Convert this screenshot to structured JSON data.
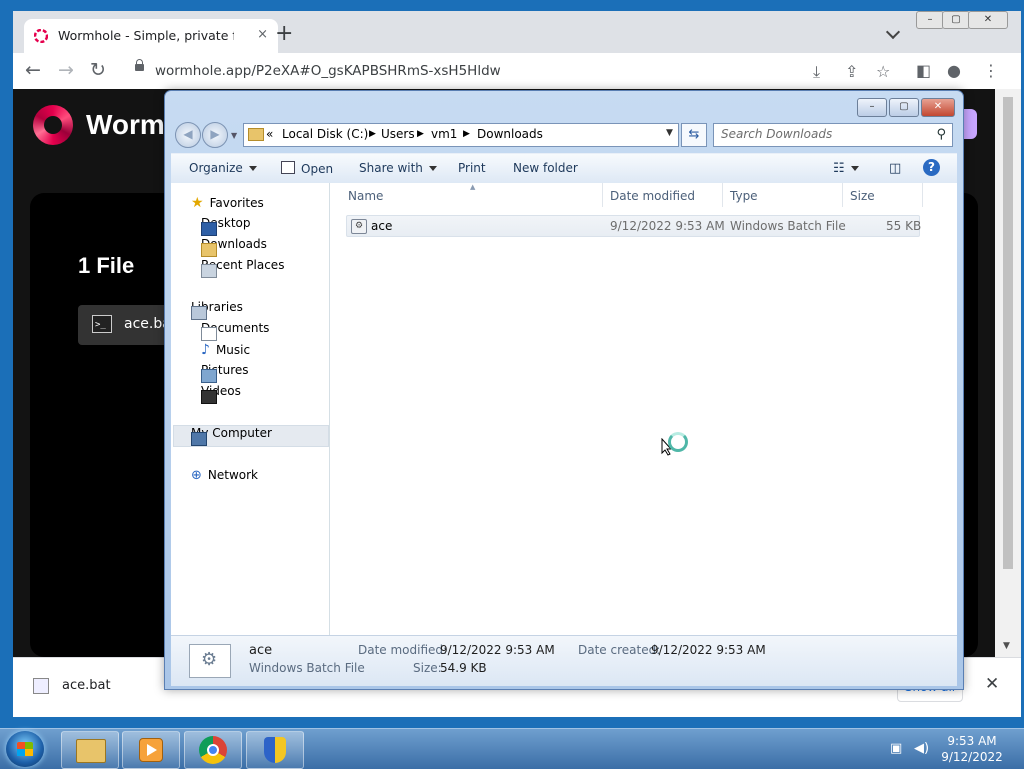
{
  "browser": {
    "tab_title": "Wormhole - Simple, private file s",
    "tab_close": "×",
    "new_tab": "+",
    "window_controls": [
      "–",
      "▢",
      "✕"
    ],
    "url": "wormhole.app/P2eXA#O_gsKAPBSHRmS-xsH5Hldw"
  },
  "wormhole_page": {
    "brand": "Worm",
    "files_heading": "1 File",
    "file_name": "ace.ba",
    "file_icon_text": ">_"
  },
  "download_bar": {
    "file_name": "ace.bat",
    "show_all": "Show all",
    "close": "✕"
  },
  "explorer": {
    "title_buttons": [
      "–",
      "▢",
      "✕"
    ],
    "breadcrumb": [
      "«",
      "Local Disk (C:)",
      "Users",
      "vm1",
      "Downloads"
    ],
    "search_placeholder": "Search Downloads",
    "commands": {
      "organize": "Organize",
      "open": "Open",
      "share_with": "Share with",
      "print": "Print",
      "new_folder": "New folder"
    },
    "nav": {
      "favorites": "Favorites",
      "desktop": "Desktop",
      "downloads": "Downloads",
      "recent_places": "Recent Places",
      "libraries": "Libraries",
      "documents": "Documents",
      "music": "Music",
      "pictures": "Pictures",
      "videos": "Videos",
      "my_computer": "My Computer",
      "network": "Network"
    },
    "columns": {
      "name": "Name",
      "date_modified": "Date modified",
      "type": "Type",
      "size": "Size"
    },
    "files": [
      {
        "name": "ace",
        "date_modified": "9/12/2022 9:53 AM",
        "type": "Windows Batch File",
        "size": "55 KB"
      }
    ],
    "details": {
      "name": "ace",
      "type": "Windows Batch File",
      "date_modified_label": "Date modified:",
      "date_modified": "9/12/2022 9:53 AM",
      "size_label": "Size:",
      "size": "54.9 KB",
      "date_created_label": "Date created:",
      "date_created": "9/12/2022 9:53 AM"
    }
  },
  "taskbar": {
    "time": "9:53 AM",
    "date": "9/12/2022"
  }
}
